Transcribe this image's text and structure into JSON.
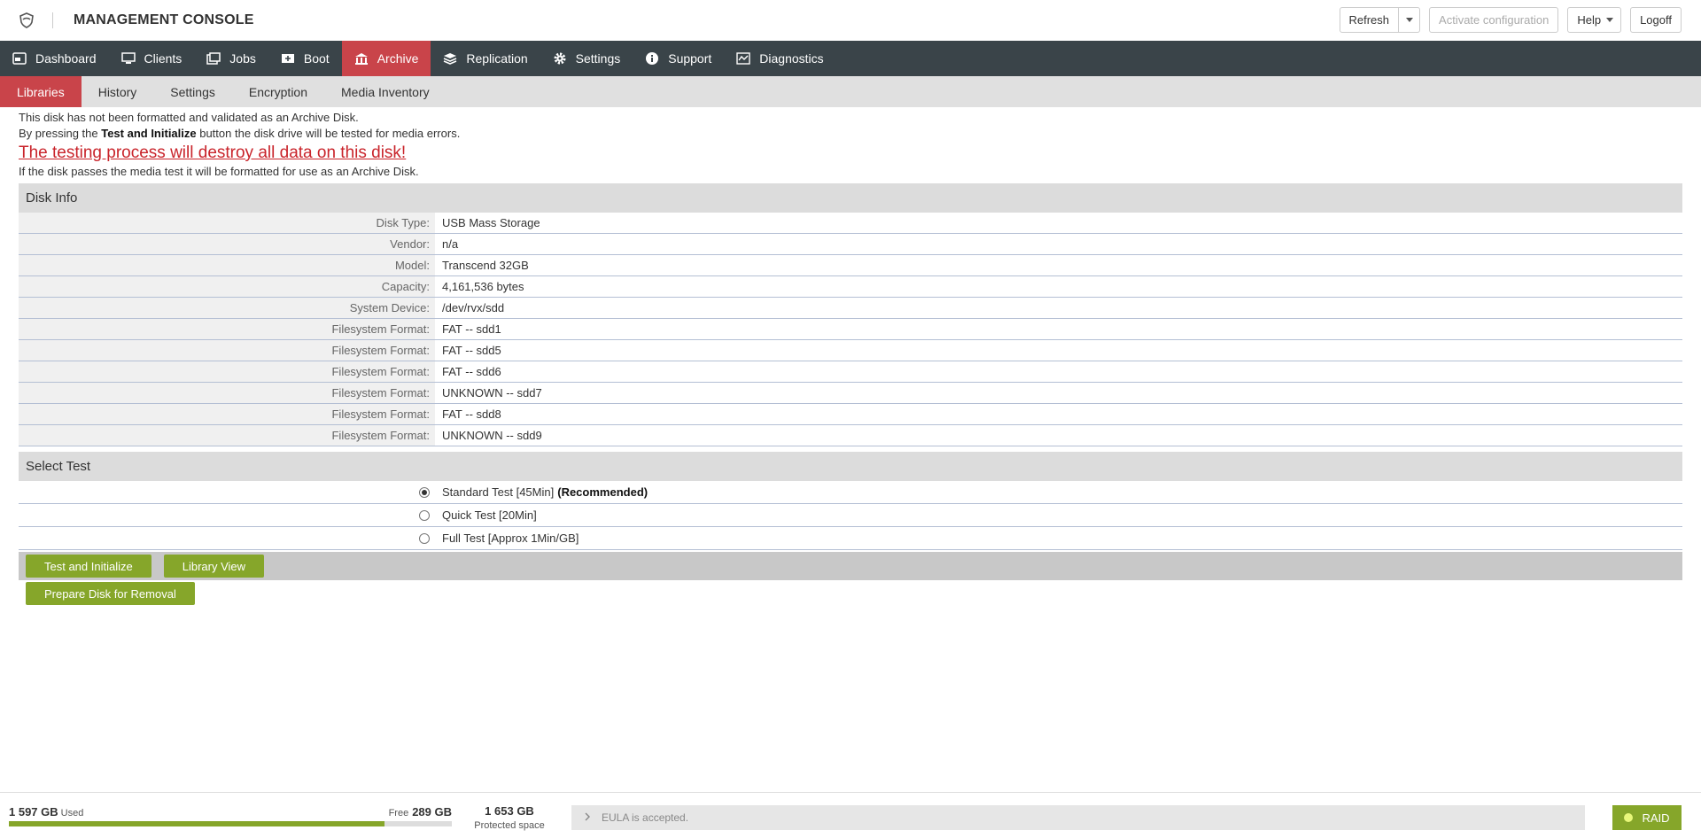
{
  "header": {
    "title": "MANAGEMENT CONSOLE",
    "refresh": "Refresh",
    "activate": "Activate configuration",
    "help": "Help",
    "logoff": "Logoff"
  },
  "mainnav": [
    {
      "label": "Dashboard",
      "icon": "dashboard-icon"
    },
    {
      "label": "Clients",
      "icon": "monitor-icon"
    },
    {
      "label": "Jobs",
      "icon": "jobs-icon"
    },
    {
      "label": "Boot",
      "icon": "boot-icon"
    },
    {
      "label": "Archive",
      "icon": "archive-icon",
      "active": true
    },
    {
      "label": "Replication",
      "icon": "layers-icon"
    },
    {
      "label": "Settings",
      "icon": "gear-icon"
    },
    {
      "label": "Support",
      "icon": "info-icon"
    },
    {
      "label": "Diagnostics",
      "icon": "diagnostics-icon"
    }
  ],
  "subnav": [
    "Libraries",
    "History",
    "Settings",
    "Encryption",
    "Media Inventory"
  ],
  "messages": {
    "line1": "This disk has not been formatted and validated as an Archive Disk.",
    "line2_pre": "By pressing the ",
    "line2_bold": "Test and Initialize",
    "line2_post": " button the disk drive will be tested for media errors.",
    "warning": "The testing process will destroy all data on this disk!",
    "line3": "If the disk passes the media test it will be formatted for use as an Archive Disk."
  },
  "disk_info": {
    "heading": "Disk Info",
    "rows": [
      {
        "k": "Disk Type:",
        "v": "USB Mass Storage"
      },
      {
        "k": "Vendor:",
        "v": "n/a"
      },
      {
        "k": "Model:",
        "v": "Transcend 32GB"
      },
      {
        "k": "Capacity:",
        "v": "4,161,536 bytes"
      },
      {
        "k": "System Device:",
        "v": "/dev/rvx/sdd"
      },
      {
        "k": "Filesystem Format:",
        "v": "FAT -- sdd1"
      },
      {
        "k": "Filesystem Format:",
        "v": "FAT -- sdd5"
      },
      {
        "k": "Filesystem Format:",
        "v": "FAT -- sdd6"
      },
      {
        "k": "Filesystem Format:",
        "v": "UNKNOWN -- sdd7"
      },
      {
        "k": "Filesystem Format:",
        "v": "FAT -- sdd8"
      },
      {
        "k": "Filesystem Format:",
        "v": "UNKNOWN -- sdd9"
      }
    ]
  },
  "select_test": {
    "heading": "Select Test",
    "options": [
      {
        "label": "Standard Test [45Min]",
        "extra": "(Recommended)",
        "selected": true
      },
      {
        "label": "Quick Test [20Min]",
        "extra": "",
        "selected": false
      },
      {
        "label": "Full Test [Approx 1Min/GB]",
        "extra": "",
        "selected": false
      }
    ]
  },
  "buttons": {
    "test_init": "Test and Initialize",
    "library_view": "Library View",
    "prepare": "Prepare Disk for Removal"
  },
  "footer": {
    "used_value": "1 597 GB",
    "used_label": "Used",
    "free_label": "Free",
    "free_value": "289 GB",
    "used_fraction": 0.847,
    "protected_value": "1 653 GB",
    "protected_label": "Protected space",
    "eula": "EULA is accepted.",
    "raid": "RAID"
  },
  "colors": {
    "accent_red": "#c9444a",
    "nav_dark": "#3a4449",
    "green": "#86a62a",
    "warning_red": "#c9242b"
  }
}
